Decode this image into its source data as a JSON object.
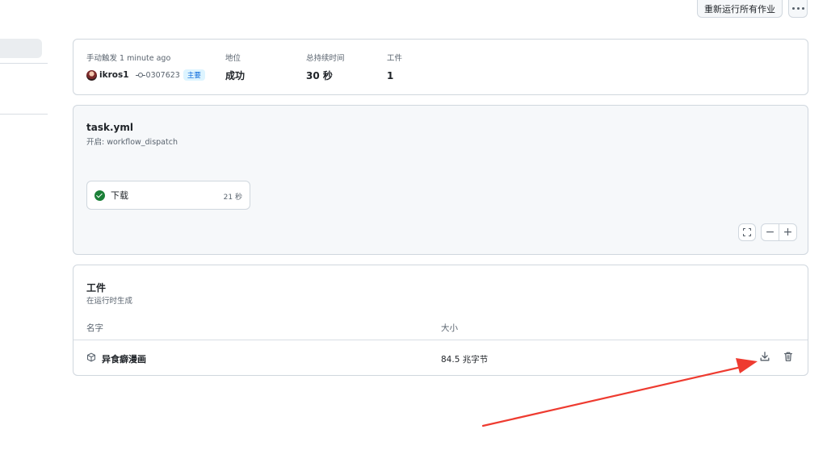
{
  "header": {
    "rerun_label": "重新运行所有作业"
  },
  "summary": {
    "trigger_label": "手动触发 1 minute ago",
    "actor": "ikros1",
    "commit_sha": "0307623",
    "branch": "主要",
    "status_label": "地位",
    "status_value": "成功",
    "duration_label": "总持续时间",
    "duration_value": "30 秒",
    "artifacts_label": "工件",
    "artifacts_value": "1"
  },
  "workflow": {
    "file": "task.yml",
    "on": "开启: workflow_dispatch",
    "job": {
      "name": "下载",
      "duration": "21 秒",
      "status": "success"
    }
  },
  "artifacts": {
    "title": "工件",
    "subtitle": "在运行时生成",
    "columns": [
      "名字",
      "大小"
    ],
    "rows": [
      {
        "name": "异食癖漫画",
        "size": "84.5 兆字节"
      }
    ]
  },
  "colors": {
    "success": "#1a7f37",
    "annotation_arrow": "#ee3b30",
    "link": "#0969da"
  }
}
